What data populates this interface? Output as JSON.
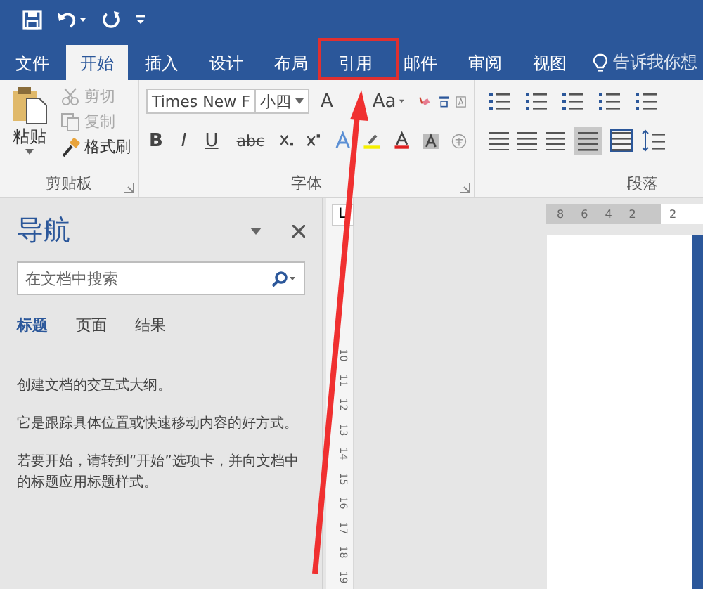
{
  "tabs": [
    {
      "label": "文件",
      "selected": false
    },
    {
      "label": "开始",
      "selected": true
    },
    {
      "label": "插入",
      "selected": false
    },
    {
      "label": "设计",
      "selected": false
    },
    {
      "label": "布局",
      "selected": false
    },
    {
      "label": "引用",
      "selected": false
    },
    {
      "label": "邮件",
      "selected": false
    },
    {
      "label": "审阅",
      "selected": false
    },
    {
      "label": "视图",
      "selected": false
    }
  ],
  "tell_me": {
    "placeholder": "告诉我你想"
  },
  "ribbon": {
    "clipboard": {
      "paste": "粘贴",
      "items": [
        {
          "kind": "cut",
          "label": "剪切",
          "disabled": true
        },
        {
          "kind": "copy",
          "label": "复制",
          "disabled": true
        },
        {
          "kind": "painter",
          "label": "格式刷",
          "disabled": false
        }
      ],
      "label": "剪贴板"
    },
    "font": {
      "font_name": "Times New F",
      "font_size": "小四",
      "grow": "A",
      "case": "Aa",
      "bold": "B",
      "italic": "I",
      "underline": "U",
      "strike": "abc",
      "label": "字体"
    },
    "paragraph": {
      "label": "段落"
    }
  },
  "navigation": {
    "title": "导航",
    "search": {
      "placeholder": "在文档中搜索"
    },
    "tabs": [
      {
        "label": "标题",
        "selected": true
      },
      {
        "label": "页面",
        "selected": false
      },
      {
        "label": "结果",
        "selected": false
      }
    ],
    "messages": [
      "创建文档的交互式大纲。",
      "它是跟踪具体位置或快速移动内容的好方式。",
      "若要开始，请转到“开始”选项卡，并向文档中的标题应用标题样式。"
    ]
  },
  "ruler": {
    "tab_stop": "L",
    "top_numbers": [
      "8",
      "6",
      "4",
      "2",
      "2"
    ],
    "side_numbers": [
      "10",
      "11",
      "12",
      "13",
      "14",
      "15",
      "16",
      "17",
      "18",
      "19"
    ]
  },
  "annotation": {
    "highlight": true,
    "arrow": true
  }
}
